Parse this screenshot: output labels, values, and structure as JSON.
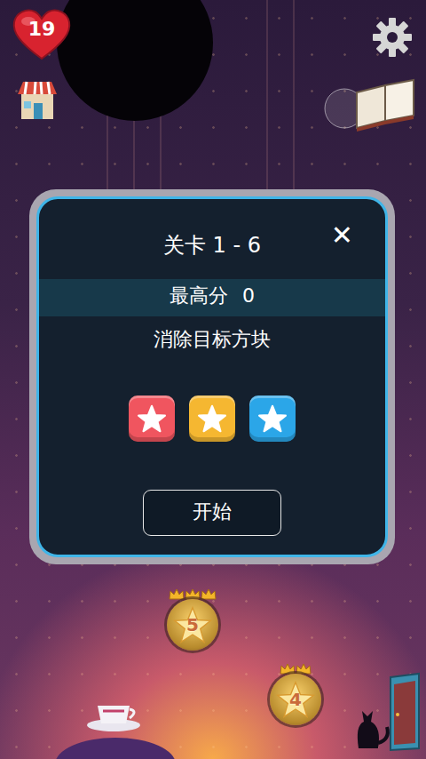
{
  "hud": {
    "lives": "19"
  },
  "dialog": {
    "title": "关卡 1 - 6",
    "close": "✕",
    "best_label": "最高分",
    "best_score": "0",
    "goal": "消除目标方块",
    "targets": [
      {
        "color": "#f0555f"
      },
      {
        "color": "#f5b731"
      },
      {
        "color": "#2ba6e8"
      }
    ],
    "start": "开始"
  },
  "map": {
    "levels": [
      {
        "number": "5",
        "stars": 3
      },
      {
        "number": "4",
        "stars": 2
      }
    ]
  }
}
